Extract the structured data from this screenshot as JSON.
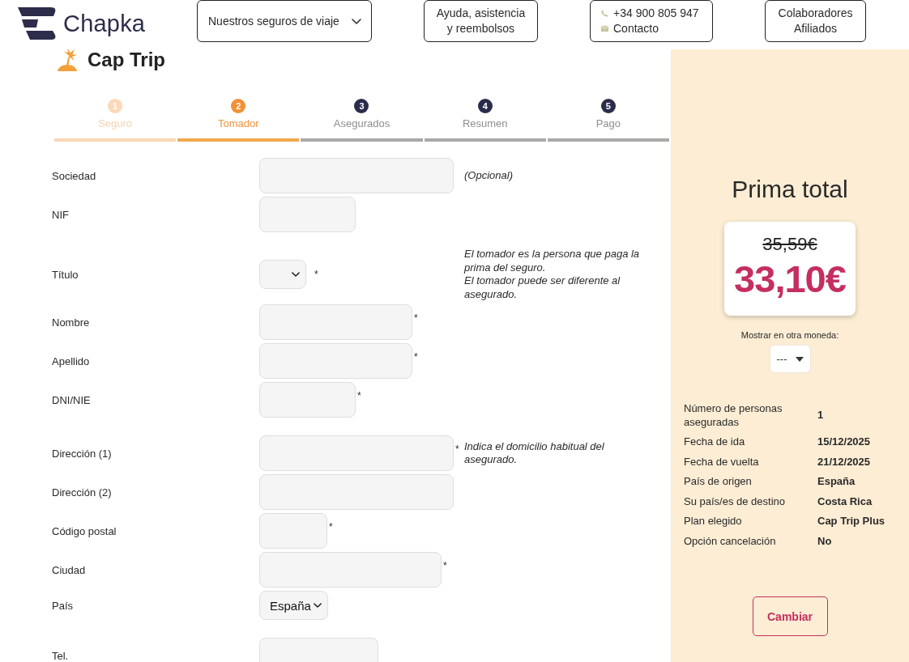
{
  "header": {
    "brand": "Chapka",
    "nav": [
      {
        "kind": "dropdown",
        "lines": [
          "Nuestros seguros de viaje"
        ]
      },
      {
        "kind": "link",
        "lines": [
          "Ayuda, asistencia",
          "y reembolsos"
        ]
      },
      {
        "kind": "contact",
        "phone": "+34 900 805 947",
        "contact": "Contacto"
      },
      {
        "kind": "link",
        "lines": [
          "Colaboradores",
          "Afiliados"
        ]
      }
    ]
  },
  "product": "Cap Trip",
  "steps": [
    {
      "number": "1",
      "label": "Seguro",
      "completed": true,
      "selected": false
    },
    {
      "number": "2",
      "label": "Tomador",
      "completed": false,
      "selected": true
    },
    {
      "number": "3",
      "label": "Asegurados",
      "completed": false,
      "selected": false
    },
    {
      "number": "4",
      "label": "Resumen",
      "completed": false,
      "selected": false
    },
    {
      "number": "5",
      "label": "Pago",
      "completed": false,
      "selected": false
    }
  ],
  "form": {
    "fields": [
      {
        "label": "Sociedad",
        "kind": "text",
        "note": [
          "(Opcional)"
        ]
      },
      {
        "label": "NIF",
        "kind": "text"
      },
      {
        "label": "Título",
        "kind": "select",
        "required_mark": "*",
        "note": [
          "El tomador es la persona que paga la prima del seguro.",
          "El tomador puede ser diferente al asegurado."
        ]
      },
      {
        "label": "Nombre",
        "kind": "text",
        "required_mark": "*"
      },
      {
        "label": "Apellido",
        "kind": "text",
        "required_mark": "*"
      },
      {
        "label": "DNI/NIE",
        "kind": "text",
        "required_mark": "*"
      },
      {
        "label": "Dirección (1)",
        "kind": "text",
        "required_mark": "*",
        "note": [
          "Indica el domicilio habitual del asegurado."
        ]
      },
      {
        "label": "Dirección (2)",
        "kind": "text"
      },
      {
        "label": "Código postal",
        "kind": "text",
        "required_mark": "*"
      },
      {
        "label": "Ciudad",
        "kind": "text",
        "required_mark": "*"
      },
      {
        "label": "País",
        "kind": "select",
        "value": "España"
      },
      {
        "label": "Tel.",
        "kind": "text"
      }
    ]
  },
  "summary": {
    "title": "Prima total",
    "old_price": "35,59€",
    "price": "33,10€",
    "currency": {
      "label": "Mostrar en otra moneda:",
      "value": "---"
    },
    "details": [
      {
        "label": "Número de personas aseguradas",
        "value": "1"
      },
      {
        "label": "Fecha de ida",
        "value": "15/12/2025"
      },
      {
        "label": "Fecha de vuelta",
        "value": "21/12/2025"
      },
      {
        "label": "País de origen",
        "value": "España"
      },
      {
        "label": "Su país/es de destino",
        "value": "Costa Rica"
      },
      {
        "label": "Plan elegido",
        "value": "Cap Trip Plus"
      },
      {
        "label": "Opción cancelación",
        "value": "No"
      }
    ],
    "button": "Cambiar"
  }
}
